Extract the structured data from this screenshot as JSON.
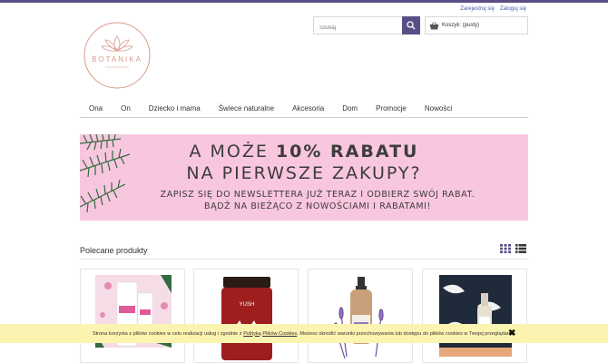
{
  "colors": {
    "accent": "#5a4e86",
    "banner_bg": "#f9c6df",
    "cookie_bg": "#fbf4b0",
    "logo_rose": "#d99a8c"
  },
  "header": {
    "register_label": "Zarejestruj się",
    "login_label": "Zaloguj się",
    "logo_text": "BOTANIKA",
    "search": {
      "placeholder": "Szukaj",
      "icon": "search-icon"
    },
    "cart": {
      "label": "Koszyk: (pusty)",
      "icon": "basket-icon"
    }
  },
  "nav": {
    "items": [
      {
        "label": "Ona"
      },
      {
        "label": "On"
      },
      {
        "label": "Dziecko i mama"
      },
      {
        "label": "Świece naturalne"
      },
      {
        "label": "Akcesoria"
      },
      {
        "label": "Dom"
      },
      {
        "label": "Promocje"
      },
      {
        "label": "Nowości"
      }
    ]
  },
  "banner": {
    "line1_prefix": "A MOŻE ",
    "line1_bold": "10% RABATU",
    "line2": "NA PIERWSZE ZAKUPY?",
    "line3": "ZAPISZ SIĘ DO NEWSLETTERA JUŻ TERAZ I ODBIERZ SWÓJ RABAT.",
    "line4": "BĄDŹ NA BIEŻĄCO Z NOWOŚCIAMI I RABATAMI!"
  },
  "featured": {
    "title": "Polecane produkty",
    "view_icons": [
      "grid-view-icon",
      "list-view-icon"
    ],
    "products": [
      {
        "name": "product-pink-cream",
        "jar_label": ""
      },
      {
        "name": "product-candle-jar",
        "jar_label": "YUSH"
      },
      {
        "name": "product-spray-bottle",
        "jar_label": ""
      },
      {
        "name": "product-dropper-bottle",
        "jar_label": ""
      }
    ]
  },
  "cookie": {
    "text_before": "Strona korzysta z plików cookies w celu realizacji usług i zgodnie z ",
    "link_text": "Polityką Plików Cookies",
    "text_after": ". Możesz określić warunki przechowywania lub dostępu do plików cookies w Twojej przeglądarce.",
    "close_icon": "close-icon"
  }
}
